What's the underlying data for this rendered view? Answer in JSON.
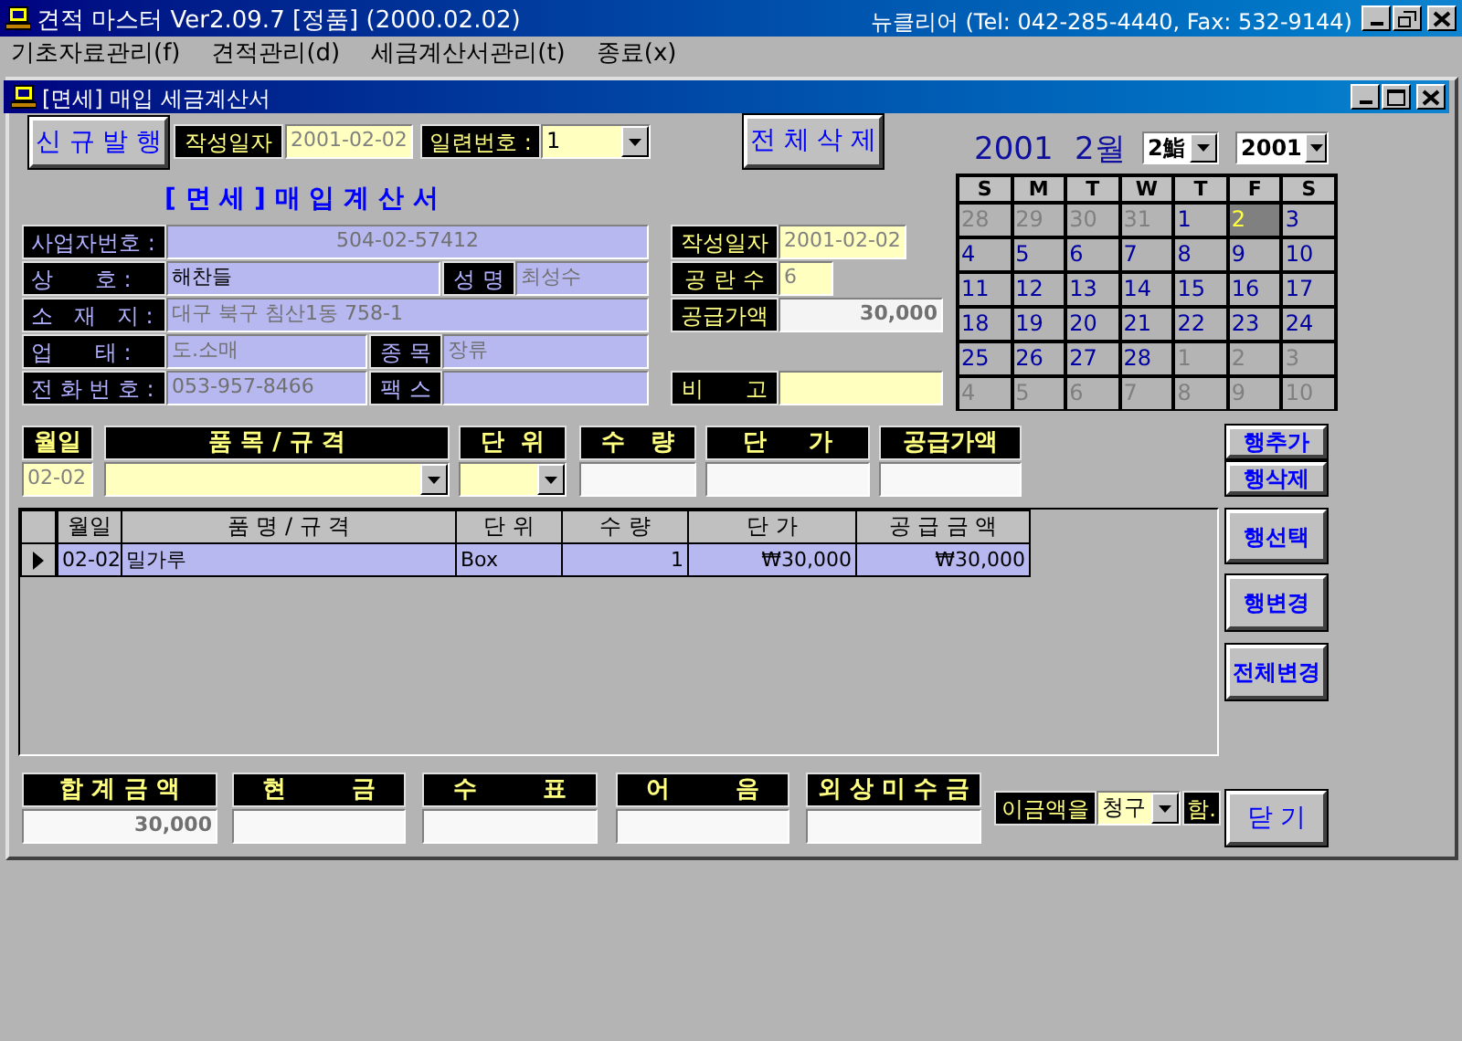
{
  "app": {
    "title": "견적 마스터 Ver2.09.7 [정품] (2000.02.02)",
    "company": "뉴클리어 (Tel: 042-285-4440, Fax: 532-9144)"
  },
  "menu": [
    "기초자료관리(f)",
    "견적관리(d)",
    "세금계산서관리(t)",
    "종료(x)"
  ],
  "window": {
    "title": "[면세] 매입 세금계산서"
  },
  "top": {
    "new_button": "신 규 발 행",
    "date_label": "작성일자",
    "date_value": "2001-02-02",
    "serial_label": "일련번호 :",
    "serial_value": "1",
    "delete_all_button": "전 체 삭 제"
  },
  "calendar": {
    "year": "2001",
    "month": "2월",
    "month_select": "2鮨",
    "year_select": "2001",
    "weekdays": [
      "S",
      "M",
      "T",
      "W",
      "T",
      "F",
      "S"
    ],
    "weeks": [
      [
        {
          "day": "28",
          "other": true,
          "selected": false
        },
        {
          "day": "29",
          "other": true,
          "selected": false
        },
        {
          "day": "30",
          "other": true,
          "selected": false
        },
        {
          "day": "31",
          "other": true,
          "selected": false
        },
        {
          "day": "1",
          "other": false,
          "selected": false
        },
        {
          "day": "2",
          "other": false,
          "selected": true
        },
        {
          "day": "3",
          "other": false,
          "selected": false
        }
      ],
      [
        {
          "day": "4",
          "other": false,
          "selected": false
        },
        {
          "day": "5",
          "other": false,
          "selected": false
        },
        {
          "day": "6",
          "other": false,
          "selected": false
        },
        {
          "day": "7",
          "other": false,
          "selected": false
        },
        {
          "day": "8",
          "other": false,
          "selected": false
        },
        {
          "day": "9",
          "other": false,
          "selected": false
        },
        {
          "day": "10",
          "other": false,
          "selected": false
        }
      ],
      [
        {
          "day": "11",
          "other": false,
          "selected": false
        },
        {
          "day": "12",
          "other": false,
          "selected": false
        },
        {
          "day": "13",
          "other": false,
          "selected": false
        },
        {
          "day": "14",
          "other": false,
          "selected": false
        },
        {
          "day": "15",
          "other": false,
          "selected": false
        },
        {
          "day": "16",
          "other": false,
          "selected": false
        },
        {
          "day": "17",
          "other": false,
          "selected": false
        }
      ],
      [
        {
          "day": "18",
          "other": false,
          "selected": false
        },
        {
          "day": "19",
          "other": false,
          "selected": false
        },
        {
          "day": "20",
          "other": false,
          "selected": false
        },
        {
          "day": "21",
          "other": false,
          "selected": false
        },
        {
          "day": "22",
          "other": false,
          "selected": false
        },
        {
          "day": "23",
          "other": false,
          "selected": false
        },
        {
          "day": "24",
          "other": false,
          "selected": false
        }
      ],
      [
        {
          "day": "25",
          "other": false,
          "selected": false
        },
        {
          "day": "26",
          "other": false,
          "selected": false
        },
        {
          "day": "27",
          "other": false,
          "selected": false
        },
        {
          "day": "28",
          "other": false,
          "selected": false
        },
        {
          "day": "1",
          "other": true,
          "selected": false
        },
        {
          "day": "2",
          "other": true,
          "selected": false
        },
        {
          "day": "3",
          "other": true,
          "selected": false
        }
      ],
      [
        {
          "day": "4",
          "other": true,
          "selected": false
        },
        {
          "day": "5",
          "other": true,
          "selected": false
        },
        {
          "day": "6",
          "other": true,
          "selected": false
        },
        {
          "day": "7",
          "other": true,
          "selected": false
        },
        {
          "day": "8",
          "other": true,
          "selected": false
        },
        {
          "day": "9",
          "other": true,
          "selected": false
        },
        {
          "day": "10",
          "other": true,
          "selected": false
        }
      ]
    ]
  },
  "heading": "[ 면 세 ] 매 입 계 산 서",
  "supplier": {
    "business_no_label": "사업자번호 :",
    "business_no": "504-02-57412",
    "company_label": "상      호 :",
    "company": "해찬들",
    "name_label": "성 명",
    "name": "최성수",
    "address_label": "소   재   지 :",
    "address": "대구 북구 침산1동 758-1",
    "business_type_label": "업      태 :",
    "business_type": "도.소매",
    "item_label": "종 목",
    "item": "장류",
    "phone_label": "전 화 번 호 :",
    "phone": "053-957-8466",
    "fax_label": "팩 스"
  },
  "summary": {
    "date_label": "작성일자",
    "date": "2001-02-02",
    "blanks_label": "공 란 수",
    "blanks": "6",
    "supply_label": "공급가액",
    "supply": "30,000",
    "note_label": "비      고"
  },
  "entry": {
    "headers": [
      "월일",
      "품 목 / 규 격",
      "단  위",
      "수   량",
      "단     가",
      "공급가액"
    ],
    "date": "02-02"
  },
  "grid": {
    "columns": [
      "월일",
      "품 명 / 규 격",
      "단 위",
      "수 량",
      "단 가",
      "공 급 금 액"
    ],
    "rows": [
      {
        "selected": true,
        "cells": [
          "02-02",
          "밀가루",
          "Box",
          "1",
          "₩30,000",
          "₩30,000"
        ]
      }
    ]
  },
  "side_buttons": [
    "행추가",
    "행삭제",
    "행선택",
    "행변경",
    "전체변경"
  ],
  "totals": [
    {
      "label": "합 계 금 액",
      "value": "30,000"
    },
    {
      "label": "현        금"
    },
    {
      "label": "수        표"
    },
    {
      "label": "어        음"
    },
    {
      "label": "외 상 미 수 금"
    }
  ],
  "claim": {
    "label": "이금액을",
    "value": "청구",
    "suffix": "함."
  },
  "close_button": "닫 기"
}
